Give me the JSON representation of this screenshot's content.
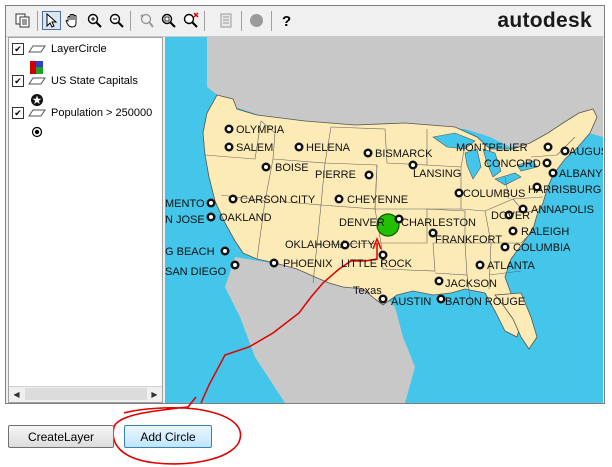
{
  "toolbar": {
    "tools": [
      {
        "name": "copy-icon"
      },
      {
        "name": "select-arrow-icon"
      },
      {
        "name": "pan-hand-icon"
      },
      {
        "name": "zoom-in-icon"
      },
      {
        "name": "zoom-out-icon"
      },
      {
        "name": "zoom-previous-icon"
      },
      {
        "name": "zoom-window-icon"
      },
      {
        "name": "zoom-extents-icon"
      },
      {
        "name": "properties-icon"
      },
      {
        "name": "stop-icon"
      },
      {
        "name": "help-icon"
      }
    ],
    "logo_text": "autodesk"
  },
  "legend": {
    "layers": [
      {
        "label": "LayerCircle",
        "checked": "✔"
      },
      {
        "label": "US State Capitals",
        "checked": "✔"
      },
      {
        "label": "Population > 250000",
        "checked": "✔"
      }
    ]
  },
  "map": {
    "ocean_color": "#43c6ea",
    "land_color": "#fcebb6",
    "circle_color": "#22c000",
    "annotation_color": "#e00000",
    "cities": [
      "OLYMPIA",
      "SALEM",
      "HELENA",
      "BISMARCK",
      "MONTPELIER",
      "AUGUSTA",
      "CONCORD",
      "ALBANY",
      "BOISE",
      "PIERRE",
      "LANSING",
      "HARRISBURG",
      "MENTO",
      "CARSON CITY",
      "CHEYENNE",
      "COLUMBUS",
      "N JOSE",
      "OAKLAND",
      "DENVER",
      "CHARLESTON",
      "DOVER",
      "ANNAPOLIS",
      "RALEIGH",
      "FRANKFORT",
      "OKLAHOMA CITY",
      "COLUMBIA",
      "G BEACH",
      "PHOENIX",
      "LITTLE ROCK",
      "ATLANTA",
      "SAN DIEGO",
      "JACKSON",
      "Texas",
      "AUSTIN",
      "BATON ROUGE"
    ]
  },
  "buttons": {
    "create_layer": "CreateLayer",
    "add_circle": "Add Circle"
  }
}
